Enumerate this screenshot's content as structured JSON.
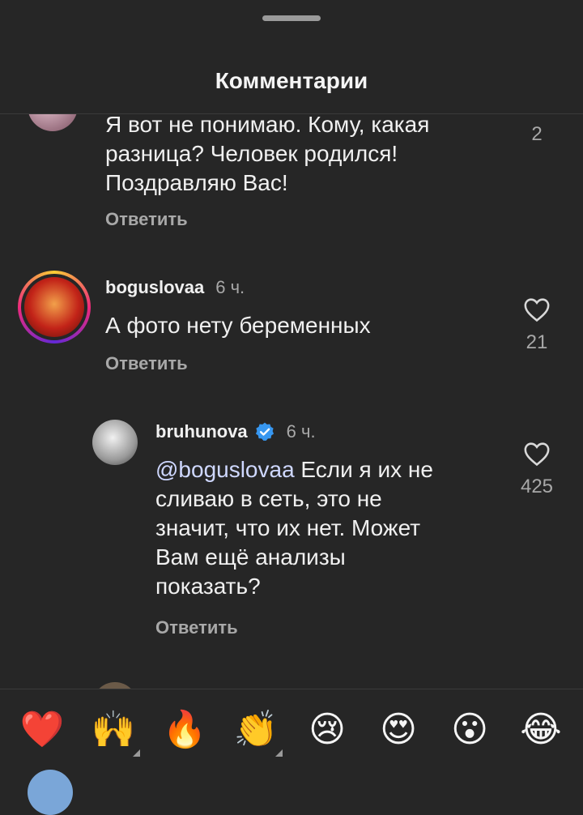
{
  "header": {
    "title": "Комментарии"
  },
  "comments": [
    {
      "text_lines": [
        "Я вот не понимаю. Кому, какая",
        "разница? Человек родился!",
        "Поздравляю Вас!"
      ],
      "reply_label": "Ответить",
      "likes": "2"
    },
    {
      "username": "boguslovaa",
      "time": "6 ч.",
      "text": "А фото нету беременных",
      "reply_label": "Ответить",
      "likes": "21"
    },
    {
      "username": "bruhunova",
      "verified": true,
      "time": "6 ч.",
      "mention": "@boguslovaa",
      "text_lines": [
        " Если я их не",
        "сливаю в сеть, это не",
        "значит, что их нет. Может",
        "Вам ещё анализы",
        "показать?"
      ],
      "reply_label": "Ответить",
      "likes": "425"
    }
  ],
  "emoji_bar": {
    "emojis": [
      {
        "char": "❤️",
        "name": "red-heart"
      },
      {
        "char": "🙌",
        "name": "raising-hands"
      },
      {
        "char": "🔥",
        "name": "fire"
      },
      {
        "char": "👏",
        "name": "clapping-hands"
      },
      {
        "char": "😢",
        "name": "crying-face"
      },
      {
        "char": "😍",
        "name": "heart-eyes"
      },
      {
        "char": "😮",
        "name": "open-mouth"
      },
      {
        "char": "😂",
        "name": "tears-of-joy"
      }
    ]
  },
  "colors": {
    "background": "#262626",
    "text": "#f5f5f5",
    "muted": "#a8a8a8",
    "verified": "#3797f0"
  }
}
